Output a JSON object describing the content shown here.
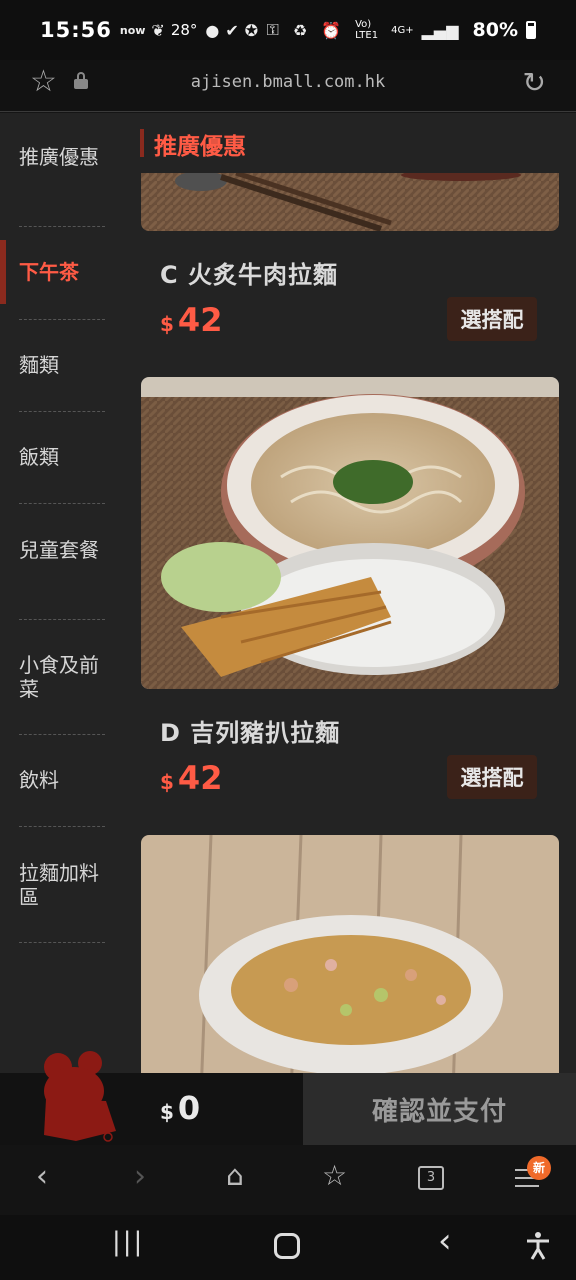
{
  "status_bar": {
    "time": "15:56",
    "now_label": "now",
    "temperature": "28°",
    "network": "Vo) LTE1",
    "signal_label": "4G+",
    "battery": "80%"
  },
  "browser": {
    "url": "ajisen.bmall.com.hk"
  },
  "sidebar": {
    "items": [
      {
        "label": "推廣優惠"
      },
      {
        "label": "下午茶"
      },
      {
        "label": "麵類"
      },
      {
        "label": "飯類"
      },
      {
        "label": "兒童套餐"
      },
      {
        "label": "小食及前菜"
      },
      {
        "label": "飲料"
      },
      {
        "label": "拉麵加料區"
      }
    ],
    "active_index": 1
  },
  "section": {
    "title": "推廣優惠"
  },
  "products": [
    {
      "name": "C 火炙牛肉拉麵",
      "currency": "$",
      "price": "42",
      "button": "選搭配"
    },
    {
      "name": "D 吉列豬扒拉麵",
      "currency": "$",
      "price": "42",
      "button": "選搭配"
    }
  ],
  "cart": {
    "currency": "$",
    "total": "0",
    "pay_button": "確認並支付"
  },
  "browser_nav": {
    "tabs_count": "3",
    "new_badge": "新"
  },
  "colors": {
    "accent": "#ff5b45",
    "button_bg": "#3b2219",
    "panel_bg": "#232323"
  }
}
